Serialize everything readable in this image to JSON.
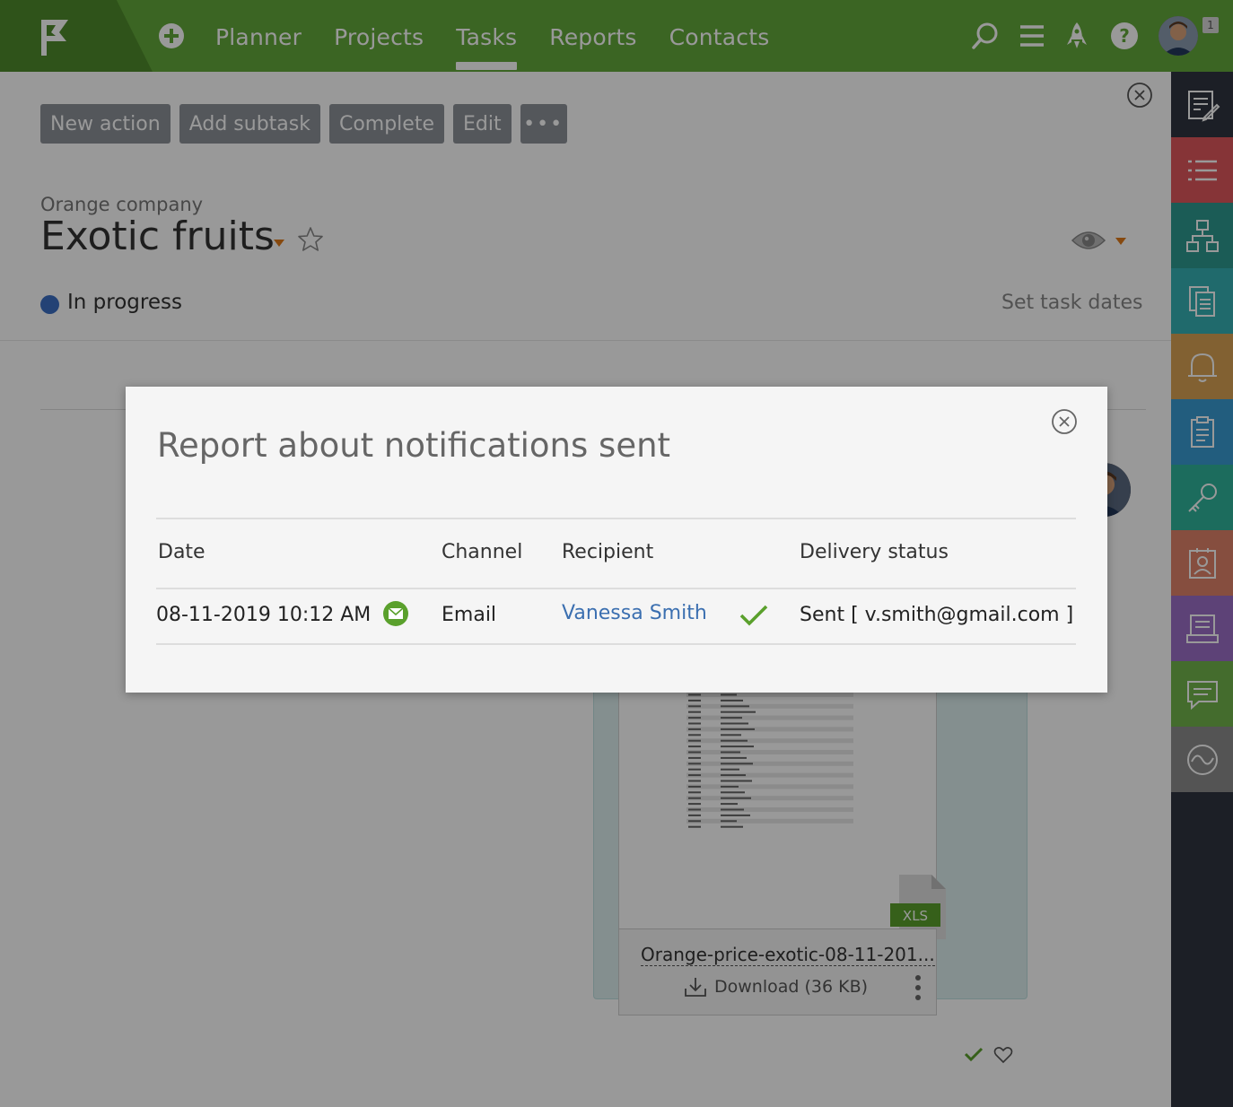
{
  "nav": {
    "items": [
      {
        "label": "Planner",
        "active": false
      },
      {
        "label": "Projects",
        "active": false
      },
      {
        "label": "Tasks",
        "active": true
      },
      {
        "label": "Reports",
        "active": false
      },
      {
        "label": "Contacts",
        "active": false
      }
    ],
    "notification_count": "1"
  },
  "toolbar": {
    "new_action": "New action",
    "add_subtask": "Add subtask",
    "complete": "Complete",
    "edit": "Edit",
    "more": "•••"
  },
  "task": {
    "company": "Orange company",
    "title": "Exotic fruits",
    "status": "In progress",
    "status_color": "#3b6fc4",
    "set_dates": "Set task dates"
  },
  "attachment": {
    "file_name": "Orange-price-exotic-08-11-201...",
    "download_label": "Download (36 KB)",
    "file_type": "XLS"
  },
  "modal": {
    "title": "Report about notifications sent",
    "columns": {
      "date": "Date",
      "channel": "Channel",
      "recipient": "Recipient",
      "delivery_status": "Delivery status"
    },
    "rows": [
      {
        "date": "08-11-2019 10:12 AM",
        "channel": "Email",
        "recipient": "Vanessa Smith",
        "delivery_status": "Sent [ v.smith@gmail.com ]"
      }
    ]
  },
  "colors": {
    "topbar": "#63a83b",
    "accent_orange": "#e07b1a",
    "link": "#3b6fb0",
    "success": "#5aa02c"
  },
  "sidebar": {
    "icons": [
      "edit-note-icon",
      "list-icon",
      "hierarchy-icon",
      "documents-icon",
      "bell-icon",
      "clipboard-icon",
      "key-icon",
      "contact-card-icon",
      "presentation-icon",
      "chat-icon",
      "wave-icon"
    ]
  }
}
